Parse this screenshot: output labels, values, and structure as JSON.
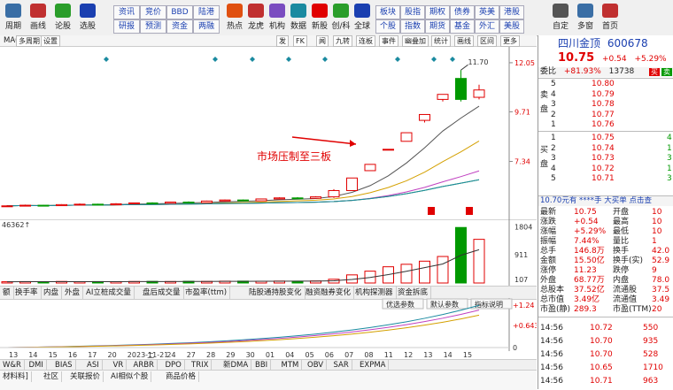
{
  "colors": {
    "up": "#e00000",
    "down": "#009900",
    "accent": "#1a3fb0",
    "ma5": "#555555",
    "ma10": "#d4a000",
    "ma20": "#c040c0",
    "ma30": "#2a9d2a",
    "ma60": "#1a8aa0"
  },
  "toolbar": {
    "buttons": [
      {
        "label": "周期",
        "icon": "calendar-icon"
      },
      {
        "label": "画线",
        "icon": "pen-icon"
      },
      {
        "label": "论股",
        "icon": "chat-icon"
      },
      {
        "label": "选股",
        "icon": "search-icon"
      }
    ],
    "grid_top": [
      "资讯",
      "竞价",
      "BBD",
      "陆港"
    ],
    "grid_bottom": [
      "研报",
      "预测",
      "资金",
      "两融"
    ],
    "mid_buttons": [
      {
        "label": "热点",
        "icon": "fire-icon"
      },
      {
        "label": "龙虎",
        "icon": "dragon-icon"
      },
      {
        "label": "机构",
        "icon": "building-icon"
      },
      {
        "label": "数据",
        "icon": "database-icon"
      },
      {
        "label": "新股",
        "icon": "new-icon"
      },
      {
        "label": "创/科",
        "icon": "chart-icon"
      },
      {
        "label": "全球",
        "icon": "globe-icon"
      }
    ],
    "grid2_top": [
      "板块",
      "股指",
      "期权",
      "债券",
      "英美",
      "港股"
    ],
    "grid2_bottom": [
      "个股",
      "指数",
      "期货",
      "基金",
      "外汇",
      "美股"
    ],
    "right_buttons": [
      {
        "label": "自定",
        "icon": "custom-icon"
      },
      {
        "label": "多窗",
        "icon": "windows-icon"
      },
      {
        "label": "首页",
        "icon": "home-icon"
      }
    ]
  },
  "chart_tabs": {
    "left": [
      "多周期",
      "设置"
    ],
    "ma_label": "MA60: 5.47↑",
    "right": [
      "发",
      "FK",
      "闻",
      "九转",
      "连板",
      "事件",
      "幽叠加",
      "统计",
      "画线",
      "区间",
      "更多"
    ]
  },
  "chart_data": [
    {
      "type": "candlestick",
      "yaxis_ticks": [
        "12.05",
        "9.71",
        "7.34"
      ],
      "max_label": "11.70",
      "annotation": "市场压制至三板",
      "candles": [
        {
          "o": 5.2,
          "c": 5.22,
          "h": 5.25,
          "l": 5.18
        },
        {
          "o": 5.22,
          "c": 5.25,
          "h": 5.28,
          "l": 5.2
        },
        {
          "o": 5.25,
          "c": 5.23,
          "h": 5.27,
          "l": 5.21
        },
        {
          "o": 5.23,
          "c": 5.28,
          "h": 5.3,
          "l": 5.22
        },
        {
          "o": 5.28,
          "c": 5.3,
          "h": 5.33,
          "l": 5.26
        },
        {
          "o": 5.3,
          "c": 5.27,
          "h": 5.32,
          "l": 5.25
        },
        {
          "o": 5.27,
          "c": 5.32,
          "h": 5.35,
          "l": 5.26
        },
        {
          "o": 5.32,
          "c": 5.36,
          "h": 5.38,
          "l": 5.3
        },
        {
          "o": 5.36,
          "c": 5.34,
          "h": 5.39,
          "l": 5.32
        },
        {
          "o": 5.34,
          "c": 5.4,
          "h": 5.42,
          "l": 5.33
        },
        {
          "o": 5.4,
          "c": 5.37,
          "h": 5.43,
          "l": 5.35
        },
        {
          "o": 5.37,
          "c": 5.45,
          "h": 5.47,
          "l": 5.36
        },
        {
          "o": 5.45,
          "c": 5.5,
          "h": 5.52,
          "l": 5.43
        },
        {
          "o": 5.5,
          "c": 5.46,
          "h": 5.53,
          "l": 5.44
        },
        {
          "o": 5.46,
          "c": 5.55,
          "h": 5.57,
          "l": 5.45
        },
        {
          "o": 5.55,
          "c": 5.6,
          "h": 5.63,
          "l": 5.53
        },
        {
          "o": 5.6,
          "c": 5.58,
          "h": 5.64,
          "l": 5.55
        },
        {
          "o": 5.58,
          "c": 5.65,
          "h": 5.68,
          "l": 5.57
        },
        {
          "o": 5.65,
          "c": 5.95,
          "h": 6.02,
          "l": 5.6
        },
        {
          "o": 5.95,
          "c": 6.55,
          "h": 6.55,
          "l": 5.95
        },
        {
          "o": 6.9,
          "c": 7.2,
          "h": 7.2,
          "l": 6.9
        },
        {
          "o": 7.92,
          "c": 7.92,
          "h": 7.92,
          "l": 7.92
        },
        {
          "o": 8.3,
          "c": 8.71,
          "h": 8.71,
          "l": 8.3
        },
        {
          "o": 9.3,
          "c": 9.58,
          "h": 9.58,
          "l": 9.2
        },
        {
          "o": 10.3,
          "c": 10.54,
          "h": 10.54,
          "l": 10.2
        },
        {
          "o": 11.3,
          "c": 10.3,
          "h": 11.7,
          "l": 10.2
        },
        {
          "o": 10.4,
          "c": 10.75,
          "h": 11.0,
          "l": 10.3
        }
      ],
      "volume_label": "46362↑",
      "volume_ticks": [
        "1804",
        "911",
        "107"
      ],
      "volumes": [
        40,
        45,
        38,
        50,
        42,
        46,
        44,
        48,
        52,
        47,
        55,
        50,
        58,
        60,
        55,
        62,
        58,
        65,
        120,
        260,
        380,
        520,
        600,
        700,
        850,
        1780,
        1400
      ]
    },
    {
      "type": "line",
      "yaxis_ticks": [
        "+1.24",
        "+0.643",
        "0"
      ],
      "x": [
        "13",
        "14",
        "15",
        "16",
        "17",
        "20",
        "2023-11-21",
        "二",
        "24",
        "27",
        "28",
        "29",
        "30",
        "01",
        "04",
        "05",
        "06",
        "07",
        "08",
        "11",
        "12",
        "13",
        "14",
        "15"
      ]
    }
  ],
  "indicator_tabs": [
    "换手率",
    "内盘",
    "外盘",
    "AI立桩成交量",
    "盘后成交量",
    "市盈率(ttm)",
    "陆股通持股变化",
    "融资融券变化",
    "机构探测器",
    "资金拆底"
  ],
  "indicator_buttons": [
    "优选参数",
    "默认参数",
    "指标说明"
  ],
  "bottom_tabs": [
    "W&R",
    "DMI",
    "BIAS",
    "ASI",
    "VR",
    "ARBR",
    "DPO",
    "TRIX",
    "新DMA",
    "BBI",
    "MTM",
    "OBV",
    "SAR",
    "EXPMA"
  ],
  "status_tabs": [
    "材料料]",
    "社区",
    "关联报价",
    "AI相似个股",
    "商品价格"
  ],
  "quote": {
    "name": "四川金顶",
    "code": "600678",
    "price": "10.75",
    "change": "+0.54",
    "pct": "+5.29%",
    "weibi_label": "委比",
    "weibi": "+81.93%",
    "weibi_vol": "13738",
    "sell": [
      {
        "lvl": "5",
        "price": "10.80",
        "vol": ""
      },
      {
        "lvl": "4",
        "price": "10.79",
        "vol": ""
      },
      {
        "lvl": "3",
        "price": "10.78",
        "vol": ""
      },
      {
        "lvl": "2",
        "price": "10.77",
        "vol": ""
      },
      {
        "lvl": "1",
        "price": "10.76",
        "vol": ""
      }
    ],
    "buy": [
      {
        "lvl": "1",
        "price": "10.75",
        "vol": "4"
      },
      {
        "lvl": "2",
        "price": "10.74",
        "vol": "1"
      },
      {
        "lvl": "3",
        "price": "10.73",
        "vol": "3"
      },
      {
        "lvl": "4",
        "price": "10.72",
        "vol": "1"
      },
      {
        "lvl": "5",
        "price": "10.71",
        "vol": "3"
      }
    ],
    "sell_side": "卖盘",
    "buy_side": "买盘",
    "buy_btn": "买",
    "sell_btn": "卖",
    "big_order": "10.70元有 ****手 大买单  点击查",
    "stats": [
      {
        "k1": "最新",
        "v1": "10.75",
        "k2": "开盘",
        "v2": "10"
      },
      {
        "k1": "涨跌",
        "v1": "+0.54",
        "k2": "最高",
        "v2": "10"
      },
      {
        "k1": "涨幅",
        "v1": "+5.29%",
        "k2": "最低",
        "v2": "10"
      },
      {
        "k1": "振幅",
        "v1": "7.44%",
        "k2": "量比",
        "v2": "1"
      },
      {
        "k1": "总手",
        "v1": "146.8万",
        "k2": "换手",
        "v2": "42.0"
      },
      {
        "k1": "金额",
        "v1": "15.50亿",
        "k2": "换手(实)",
        "v2": "52.9"
      },
      {
        "k1": "涨停",
        "v1": "11.23",
        "k2": "跌停",
        "v2": "9"
      },
      {
        "k1": "外盘",
        "v1": "68.77万",
        "k2": "内盘",
        "v2": "78.0"
      },
      {
        "k1": "总股本",
        "v1": "37.52亿",
        "k2": "流通股",
        "v2": "37.5"
      },
      {
        "k1": "总市值",
        "v1": "3.49亿",
        "k2": "流通值",
        "v2": "3.49"
      },
      {
        "k1": "市盈(静)",
        "v1": "289.3",
        "k2": "市盈(TTM)",
        "v2": "20"
      }
    ],
    "ticks": [
      {
        "time": "14:56",
        "price": "10.72",
        "vol": "550"
      },
      {
        "time": "14:56",
        "price": "10.70",
        "vol": "935"
      },
      {
        "time": "14:56",
        "price": "10.70",
        "vol": "528"
      },
      {
        "time": "14:56",
        "price": "10.65",
        "vol": "1710"
      },
      {
        "time": "14:56",
        "price": "10.71",
        "vol": "963"
      }
    ]
  }
}
